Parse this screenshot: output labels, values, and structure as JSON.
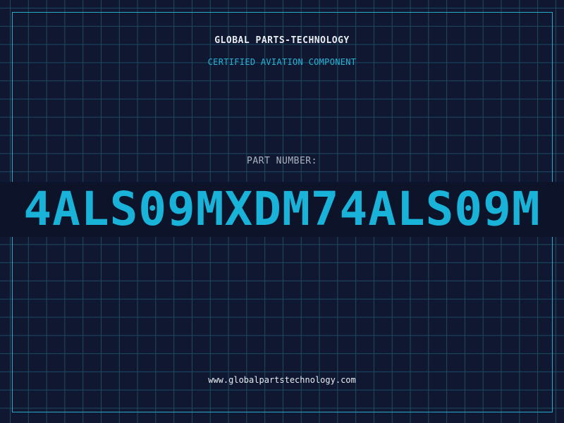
{
  "header": {
    "brand": "GLOBAL PARTS-TECHNOLOGY",
    "tagline": "CERTIFIED AVIATION COMPONENT"
  },
  "part": {
    "label": "PART NUMBER:",
    "number": "4ALS09MXDM74ALS09M"
  },
  "footer": {
    "url": "www.globalpartstechnology.com"
  },
  "colors": {
    "background": "#0f1830",
    "grid": "#1d4a63",
    "accent": "#19b3d9",
    "text": "#e8ecf2",
    "muted": "#aab3c2"
  }
}
